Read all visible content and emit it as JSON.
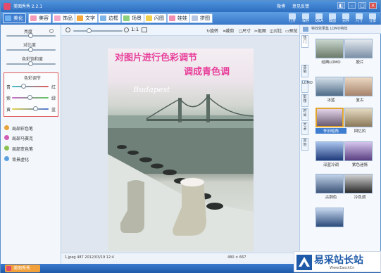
{
  "app": {
    "title": "美图秀秀 2.2.1"
  },
  "titlebar": {
    "links": [
      "微博",
      "意见反馈"
    ]
  },
  "tabs": [
    {
      "label": "美化",
      "active": true,
      "color": "#6fb0f0"
    },
    {
      "label": "美容",
      "active": false,
      "color": "#f39bb8"
    },
    {
      "label": "饰品",
      "active": false,
      "color": "#f5a9c9"
    },
    {
      "label": "文字",
      "active": false,
      "color": "#f4a63a"
    },
    {
      "label": "边框",
      "active": false,
      "color": "#7fb6e8"
    },
    {
      "label": "场景",
      "active": false,
      "color": "#8ccf7e"
    },
    {
      "label": "闪图",
      "active": false,
      "color": "#f0d04a"
    },
    {
      "label": "娃娃",
      "active": false,
      "color": "#f28fb0"
    },
    {
      "label": "拼图",
      "active": false,
      "color": "#b7c6e3"
    }
  ],
  "top_right_buttons": [
    "打开",
    "保存",
    "Q&A",
    "截图",
    "另存",
    "尺寸",
    "分享"
  ],
  "left_panel": {
    "sliders": [
      {
        "label": "亮度",
        "value": 0.52
      },
      {
        "label": "对比度",
        "value": 0.52
      },
      {
        "label": "色彩饱和度",
        "value": 0.52
      }
    ],
    "color_adjust": {
      "title": "色彩调节",
      "rows": [
        {
          "left": "青",
          "right": "红",
          "value": 0.32
        },
        {
          "left": "紫",
          "right": "绿",
          "value": 0.5
        },
        {
          "left": "黄",
          "right": "蓝",
          "value": 0.67
        }
      ]
    },
    "effects": [
      "局部彩色笔",
      "局部马赛克",
      "局部变色笔",
      "背景虚化"
    ]
  },
  "toolbar": {
    "zoom": "1:1",
    "tools": [
      "旋转",
      "裁剪",
      "尺寸",
      "抠图",
      "对比",
      "预览"
    ]
  },
  "photo": {
    "overlay_line1": "对图片进行色彩调节",
    "overlay_line2": "调成青色调",
    "city_text": "Budapest"
  },
  "status": {
    "filename": "1.jpeg  487  2012/03/19 12:4",
    "size": "480 × 667"
  },
  "right_panel": {
    "header": "特效效果集  LOMO特效",
    "vertical_tabs": [
      "热门",
      "基础",
      "LOMO",
      "影楼",
      "时尚",
      "艺术",
      "其他"
    ],
    "effects": [
      {
        "label": "经典LOMO",
        "color1": "#6c7a6a",
        "color2": "#c9d8cf",
        "selected": false
      },
      {
        "label": "胶片",
        "color1": "#7b8fa6",
        "color2": "#e4e9ef",
        "selected": false
      },
      {
        "label": "冰蓝",
        "color1": "#4e6b86",
        "color2": "#d7e2ec",
        "selected": false
      },
      {
        "label": "复古",
        "color1": "#a6836b",
        "color2": "#ecd9c4",
        "selected": false
      },
      {
        "label": "怀旧暗角",
        "color1": "#6a5c72",
        "color2": "#e4d3e9",
        "selected": true
      },
      {
        "label": "回忆风",
        "color1": "#8a7858",
        "color2": "#e7dcc4",
        "selected": false
      },
      {
        "label": "深蓝冷调",
        "color1": "#1f3a7a",
        "color2": "#a8c3ec",
        "selected": false
      },
      {
        "label": "紫色迷情",
        "color1": "#5a3f82",
        "color2": "#d5c4ec",
        "selected": false
      },
      {
        "label": "古铜色",
        "color1": "#3d5579",
        "color2": "#c3d4ea",
        "selected": false
      },
      {
        "label": "冷色调",
        "color1": "#2a2a2a",
        "color2": "#d3d3d3",
        "selected": false
      },
      {
        "label": "",
        "color1": "#2b4a7a",
        "color2": "#c7d8ef",
        "selected": false
      }
    ]
  },
  "taskbar": {
    "label": "美图秀秀"
  },
  "watermark": {
    "cn": "易采站长站",
    "url": "Www.EasckCn"
  }
}
